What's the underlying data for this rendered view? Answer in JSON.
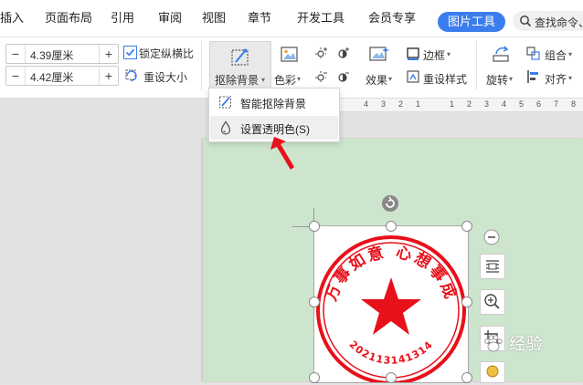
{
  "tabs": [
    "插入",
    "页面布局",
    "引用",
    "审阅",
    "视图",
    "章节",
    "开发工具",
    "会员专享",
    "图片工具"
  ],
  "search": {
    "label": "查找命令、"
  },
  "size": {
    "width": "4.39厘米",
    "height": "4.42厘米",
    "minus": "−",
    "plus": "+"
  },
  "ribbon": {
    "lock_ratio": "锁定纵横比",
    "reset_size": "重设大小",
    "remove_bg": "抠除背景",
    "color": "色彩",
    "effects": "效果",
    "border": "边框",
    "reset_style": "重设样式",
    "rotate": "旋转",
    "group": "组合",
    "align": "对齐",
    "caret": "▾"
  },
  "dropdown": {
    "items": [
      "智能抠除背景",
      "设置透明色(S)"
    ]
  },
  "ruler": {
    "marks": [
      "4",
      "3",
      "2",
      "1",
      "1",
      "2",
      "3",
      "4",
      "5",
      "6",
      "7",
      "8",
      "9",
      "10",
      "11"
    ]
  },
  "seal": {
    "top_text": "万事如意 心想事成",
    "bottom_text": "202113141314",
    "color": "#e8101a"
  },
  "watermark": "经验"
}
